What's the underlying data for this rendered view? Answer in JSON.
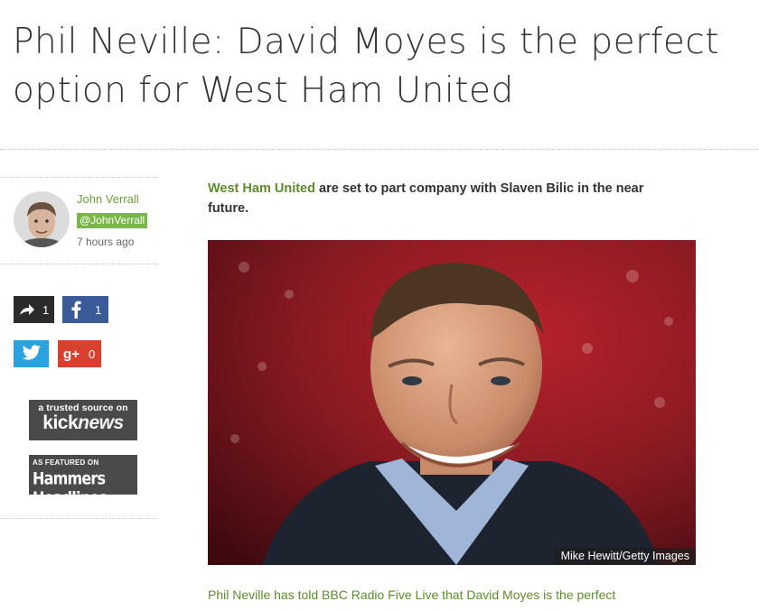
{
  "article": {
    "headline": "Phil Neville: David Moyes is the perfect option for West Ham United",
    "lead_tag": "West Ham United",
    "lead_rest": " are set to part company with Slaven Bilic in the near future.",
    "body_start": "Phil Neville has told BBC Radio Five Live that David Moyes is the perfect"
  },
  "author": {
    "name": "John Verrall",
    "handle": "@JohnVerrall",
    "time": "7 hours ago"
  },
  "social": {
    "share_count": "1",
    "facebook_count": "1",
    "gplus_label": "g+",
    "gplus_count": "0"
  },
  "badges": {
    "kicknews_small": "a trusted source on",
    "kicknews_big_a": "kick",
    "kicknews_big_b": "news",
    "hammers_small": "AS FEATURED ON",
    "hammers_big": "Hammers Headlines"
  },
  "image": {
    "credit": "Mike Hewitt/Getty Images"
  },
  "colors": {
    "accent_green": "#5f8a2f",
    "handle_bg": "#7ab648",
    "facebook": "#3b5b98",
    "twitter": "#29a3e0",
    "gplus": "#d94030"
  }
}
